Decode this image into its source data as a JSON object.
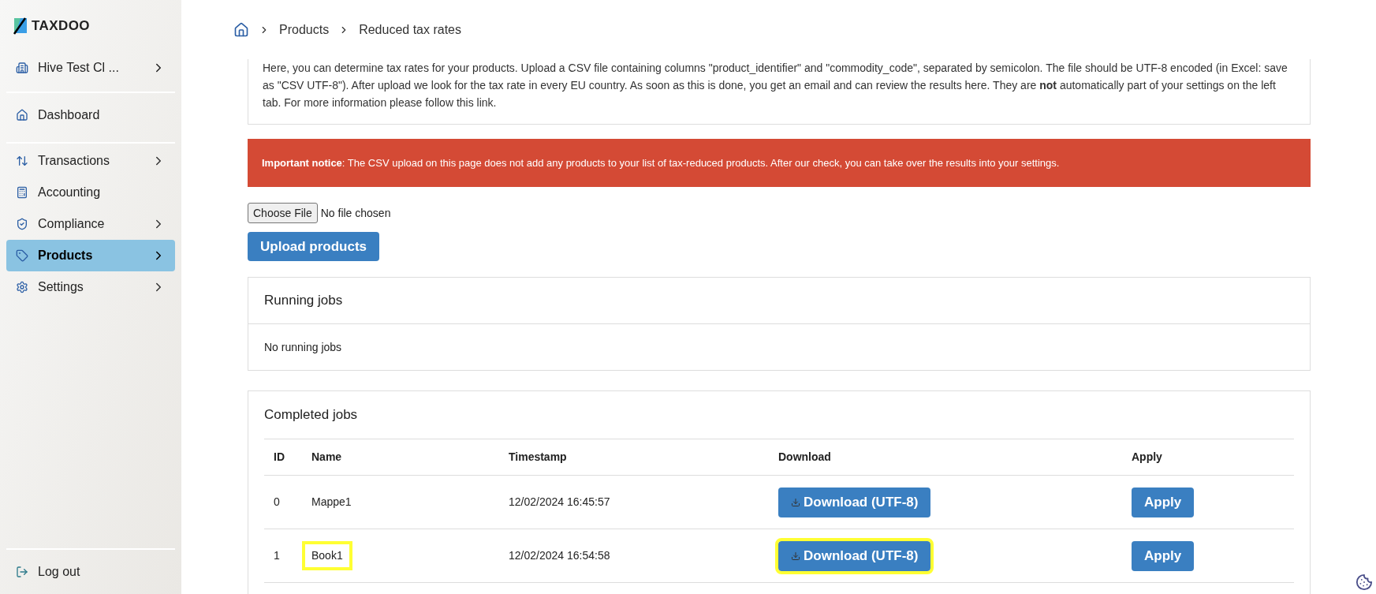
{
  "logo": {
    "text": "TAXDOO"
  },
  "client": {
    "label": "Hive Test Cl ..."
  },
  "sidebar": {
    "top_items": [
      {
        "label": "Dashboard",
        "has_children": false,
        "selected": false
      }
    ],
    "items": [
      {
        "label": "Transactions",
        "has_children": true,
        "selected": false
      },
      {
        "label": "Accounting",
        "has_children": false,
        "selected": false
      },
      {
        "label": "Compliance",
        "has_children": true,
        "selected": false
      },
      {
        "label": "Products",
        "has_children": true,
        "selected": true
      },
      {
        "label": "Settings",
        "has_children": true,
        "selected": false
      }
    ],
    "logout": "Log out"
  },
  "breadcrumb": [
    "Products",
    "Reduced tax rates"
  ],
  "description": {
    "text": "Here, you can determine tax rates for your products. Upload a CSV file containing columns \"product_identifier\" and \"commodity_code\", separated by semicolon. The file should be UTF-8 encoded (in Excel: save as \"CSV UTF-8\"). After upload we look for the tax rate in every EU country. As soon as this is done, you get an email and can review the results here. They are **not** automatically part of your settings on the left tab. For more information please follow this link."
  },
  "notice": {
    "text": "**Important notice**: The CSV upload on this page does not add any products to your list of tax-reduced products. After our check, you can take over the results into your settings."
  },
  "file_input": {
    "button": "Choose File",
    "status": "No file chosen"
  },
  "upload_button": "Upload products",
  "running_jobs": {
    "title": "Running jobs",
    "empty": "No running jobs"
  },
  "completed_jobs": {
    "title": "Completed jobs",
    "columns": [
      "ID",
      "Name",
      "Timestamp",
      "Download",
      "Apply"
    ],
    "rows": [
      {
        "id": "0",
        "name": "Mappe1",
        "timestamp": "12/02/2024 16:45:57",
        "download": "Download (UTF-8)",
        "apply": "Apply",
        "highlighted": false
      },
      {
        "id": "1",
        "name": "Book1",
        "timestamp": "12/02/2024 16:54:58",
        "download": "Download (UTF-8)",
        "apply": "Apply",
        "highlighted": true
      }
    ]
  }
}
